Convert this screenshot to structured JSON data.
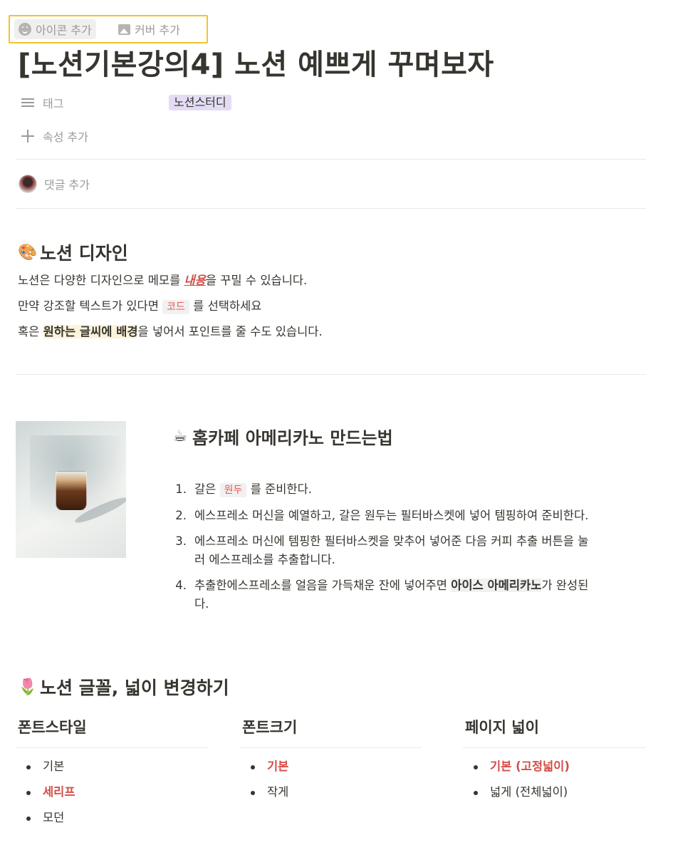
{
  "top_controls": {
    "add_icon": "아이콘 추가",
    "add_cover": "커버 추가"
  },
  "title": "[노션기본강의4] 노션 예쁘게 꾸며보자",
  "properties": {
    "tag_label": "태그",
    "tag_value": "노션스터디",
    "tag_color": "#e3dcf4",
    "add_property": "속성 추가"
  },
  "comments": {
    "add_comment": "댓글 추가"
  },
  "section1": {
    "emoji": "🎨",
    "heading": "노션 디자인",
    "line1_pre": "노션은 다양한 디자인으로  메모를 ",
    "line1_styled": "내용",
    "line1_post": "을 꾸밀 수 있습니다.",
    "line2_pre": "만약 강조할 텍스트가 있다면 ",
    "line2_code": "코드",
    "line2_post": " 를 선택하세요",
    "line3_pre": "혹은 ",
    "line3_highlight": "원하는 글씨에 배경",
    "line3_post": "을 넣어서 포인트를 줄 수도 있습니다."
  },
  "section2": {
    "emoji": "☕",
    "heading": "홈카페 아메리카노 만드는법",
    "steps": [
      {
        "num": "1.",
        "pre": "갈은 ",
        "code": "원두",
        "post": " 를 준비한다."
      },
      {
        "num": "2.",
        "text": "에스프레소 머신을 예열하고, 갈은 원두는 필터바스켓에 넣어 템핑하여 준비한다."
      },
      {
        "num": "3.",
        "line1": "에스프레소 머신에 템핑한 필터바스켓을 맞추어 넣어준 다음 커피 추출 버튼을 눌",
        "line2": "러 에스프레소를 추출합니다."
      },
      {
        "num": "4.",
        "pre": "추출한에스프레소를 얼음을 가득채운 잔에 넣어주면 ",
        "bold": "아이스 아메리카노",
        "post": "가 완성된",
        "line2": "다."
      }
    ]
  },
  "section3": {
    "emoji": "🌷",
    "heading": "노션 글꼴, 넓이 변경하기",
    "columns": [
      {
        "title": "폰트스타일",
        "items": [
          "기본",
          "세리프",
          "모던"
        ]
      },
      {
        "title": "폰트크기",
        "items": [
          "기본",
          "작게"
        ]
      },
      {
        "title": "페이지 넓이",
        "items": [
          "기본 (고정넓이)",
          "넓게 (전체넓이)"
        ]
      }
    ]
  },
  "colors": {
    "accent_red": "#d44c47",
    "text": "#37352f",
    "muted": "#9b9a97",
    "highlight": "#fbf3db"
  }
}
